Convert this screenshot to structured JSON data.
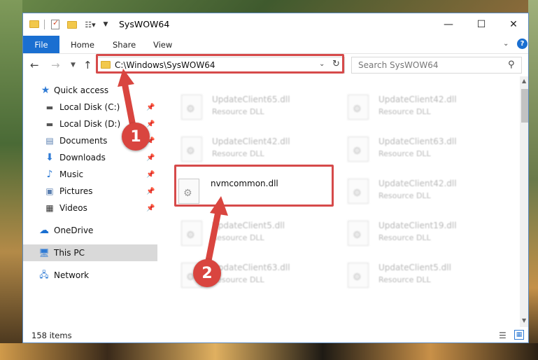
{
  "window": {
    "title": "SysWOW64",
    "minimize_glyph": "—",
    "maximize_glyph": "☐",
    "close_glyph": "✕"
  },
  "ribbon": {
    "tabs": [
      "File",
      "Home",
      "Share",
      "View"
    ],
    "help_glyph": "?"
  },
  "address": {
    "path": "C:\\Windows\\SysWOW64",
    "search_placeholder": "Search SysWOW64"
  },
  "nav_pane": {
    "items": [
      {
        "label": "Quick access",
        "icon": "star-icon"
      },
      {
        "label": "Local Disk (C:)",
        "icon": "drive-icon",
        "pinned": true
      },
      {
        "label": "Local Disk (D:)",
        "icon": "drive-icon",
        "pinned": true
      },
      {
        "label": "Documents",
        "icon": "documents-icon",
        "pinned": true
      },
      {
        "label": "Downloads",
        "icon": "download-icon",
        "pinned": true
      },
      {
        "label": "Music",
        "icon": "music-icon",
        "pinned": true
      },
      {
        "label": "Pictures",
        "icon": "pictures-icon",
        "pinned": true
      },
      {
        "label": "Videos",
        "icon": "videos-icon",
        "pinned": true
      },
      {
        "label": "OneDrive",
        "icon": "cloud-icon"
      },
      {
        "label": "This PC",
        "icon": "computer-icon",
        "selected": true
      },
      {
        "label": "Network",
        "icon": "network-icon"
      }
    ]
  },
  "files": [
    {
      "name": "UpdateClient65.dll",
      "type": "Resource DLL",
      "blurred": true
    },
    {
      "name": "UpdateClient42.dll",
      "type": "Resource DLL",
      "blurred": true
    },
    {
      "name": "UpdateClient42.dll",
      "type": "Resource DLL",
      "blurred": true
    },
    {
      "name": "UpdateClient63.dll",
      "type": "Resource DLL",
      "blurred": true
    },
    {
      "name": "nvmcommon.dll",
      "type": "",
      "blurred": false
    },
    {
      "name": "UpdateClient42.dll",
      "type": "Resource DLL",
      "blurred": true
    },
    {
      "name": "UpdateClient5.dll",
      "type": "Resource DLL",
      "blurred": true
    },
    {
      "name": "UpdateClient19.dll",
      "type": "Resource DLL",
      "blurred": true
    },
    {
      "name": "UpdateClient63.dll",
      "type": "Resource DLL",
      "blurred": true
    },
    {
      "name": "UpdateClient5.dll",
      "type": "Resource DLL",
      "blurred": true
    }
  ],
  "status": {
    "item_count": "158 items"
  },
  "annotations": {
    "step1": "1",
    "step2": "2",
    "color": "#d9453f"
  }
}
